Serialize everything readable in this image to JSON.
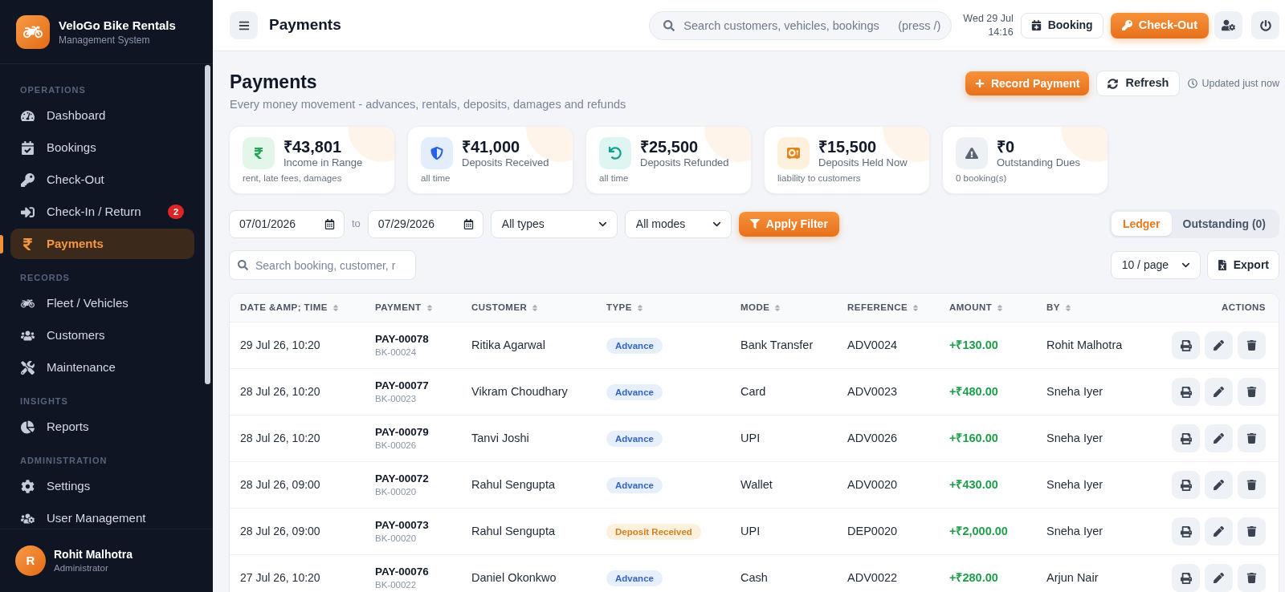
{
  "sidebar": {
    "brand": {
      "name": "VeloGo Bike Rentals",
      "tagline": "Management System"
    },
    "sections": [
      {
        "title": "OPERATIONS",
        "items": [
          {
            "label": "Dashboard",
            "selected": false
          },
          {
            "label": "Bookings",
            "selected": false
          },
          {
            "label": "Check-Out",
            "selected": false
          },
          {
            "label": "Check-In / Return",
            "selected": false,
            "badge": "2"
          },
          {
            "label": "Payments",
            "selected": true
          }
        ]
      },
      {
        "title": "RECORDS",
        "items": [
          {
            "label": "Fleet / Vehicles",
            "selected": false
          },
          {
            "label": "Customers",
            "selected": false
          },
          {
            "label": "Maintenance",
            "selected": false
          }
        ]
      },
      {
        "title": "INSIGHTS",
        "items": [
          {
            "label": "Reports",
            "selected": false
          }
        ]
      },
      {
        "title": "ADMINISTRATION",
        "items": [
          {
            "label": "Settings",
            "selected": false
          },
          {
            "label": "User Management",
            "selected": false
          }
        ]
      }
    ],
    "user": {
      "initial": "R",
      "name": "Rohit Malhotra",
      "role": "Administrator"
    }
  },
  "topbar": {
    "title": "Payments",
    "search": {
      "placeholder": "Search customers, vehicles, bookings",
      "hint": "(press /)"
    },
    "date": "Wed 29 Jul",
    "time": "14:16",
    "booking_button": "Booking",
    "checkout_button": "Check-Out"
  },
  "page_header": {
    "title": "Payments",
    "subtitle": "Every money movement - advances, rentals, deposits, damages and refunds",
    "record_button": "Record Payment",
    "refresh_button": "Refresh",
    "status": "Updated just now"
  },
  "stats": [
    {
      "kind": "income",
      "value": "₹43,801",
      "label": "Income in Range",
      "note": "rent, late fees, damages"
    },
    {
      "kind": "deposit",
      "value": "₹41,000",
      "label": "Deposits Received",
      "note": "all time"
    },
    {
      "kind": "refund",
      "value": "₹25,500",
      "label": "Deposits Refunded",
      "note": "all time"
    },
    {
      "kind": "held",
      "value": "₹15,500",
      "label": "Deposits Held Now",
      "note": "liability to customers"
    },
    {
      "kind": "dues",
      "value": "₹0",
      "label": "Outstanding Dues",
      "note": "0 booking(s)"
    }
  ],
  "filters": {
    "date_from": "07/01/2026",
    "range_separator": "to",
    "date_to": "07/29/2026",
    "type_select": "All types",
    "mode_select": "All modes",
    "apply_button": "Apply Filter"
  },
  "view_tabs": [
    {
      "label": "Ledger",
      "selected": true
    },
    {
      "label": "Outstanding (0)",
      "selected": false
    }
  ],
  "table_search": {
    "placeholder": "Search booking, customer, r"
  },
  "page_size_select": "10 / page",
  "export_button": "Export",
  "table": {
    "columns": [
      {
        "label": "DATE &AMP; TIME",
        "sortable": true
      },
      {
        "label": "PAYMENT",
        "sortable": true
      },
      {
        "label": "CUSTOMER",
        "sortable": true
      },
      {
        "label": "TYPE",
        "sortable": true
      },
      {
        "label": "MODE",
        "sortable": true
      },
      {
        "label": "REFERENCE",
        "sortable": true
      },
      {
        "label": "AMOUNT",
        "sortable": true
      },
      {
        "label": "BY",
        "sortable": true
      },
      {
        "label": "ACTIONS",
        "sortable": false
      }
    ],
    "rows": [
      {
        "date": "29 Jul 26, 10:20",
        "payment": "PAY-00078",
        "booking": "BK-00024",
        "customer": "Ritika Agarwal",
        "type": {
          "label": "Advance",
          "kind": "advance"
        },
        "mode": "Bank Transfer",
        "reference": "ADV0024",
        "amount": "+₹130.00",
        "by": "Rohit Malhotra"
      },
      {
        "date": "28 Jul 26, 10:20",
        "payment": "PAY-00077",
        "booking": "BK-00023",
        "customer": "Vikram Choudhary",
        "type": {
          "label": "Advance",
          "kind": "advance"
        },
        "mode": "Card",
        "reference": "ADV0023",
        "amount": "+₹480.00",
        "by": "Sneha Iyer"
      },
      {
        "date": "28 Jul 26, 10:20",
        "payment": "PAY-00079",
        "booking": "BK-00026",
        "customer": "Tanvi Joshi",
        "type": {
          "label": "Advance",
          "kind": "advance"
        },
        "mode": "UPI",
        "reference": "ADV0026",
        "amount": "+₹160.00",
        "by": "Sneha Iyer"
      },
      {
        "date": "28 Jul 26, 09:00",
        "payment": "PAY-00072",
        "booking": "BK-00020",
        "customer": "Rahul Sengupta",
        "type": {
          "label": "Advance",
          "kind": "advance"
        },
        "mode": "Wallet",
        "reference": "ADV0020",
        "amount": "+₹430.00",
        "by": "Sneha Iyer"
      },
      {
        "date": "28 Jul 26, 09:00",
        "payment": "PAY-00073",
        "booking": "BK-00020",
        "customer": "Rahul Sengupta",
        "type": {
          "label": "Deposit Received",
          "kind": "deposit"
        },
        "mode": "UPI",
        "reference": "DEP0020",
        "amount": "+₹2,000.00",
        "by": "Sneha Iyer"
      },
      {
        "date": "27 Jul 26, 10:20",
        "payment": "PAY-00076",
        "booking": "BK-00022",
        "customer": "Daniel Okonkwo",
        "type": {
          "label": "Advance",
          "kind": "advance"
        },
        "mode": "Cash",
        "reference": "ADV0022",
        "amount": "+₹280.00",
        "by": "Arjun Nair"
      }
    ]
  }
}
